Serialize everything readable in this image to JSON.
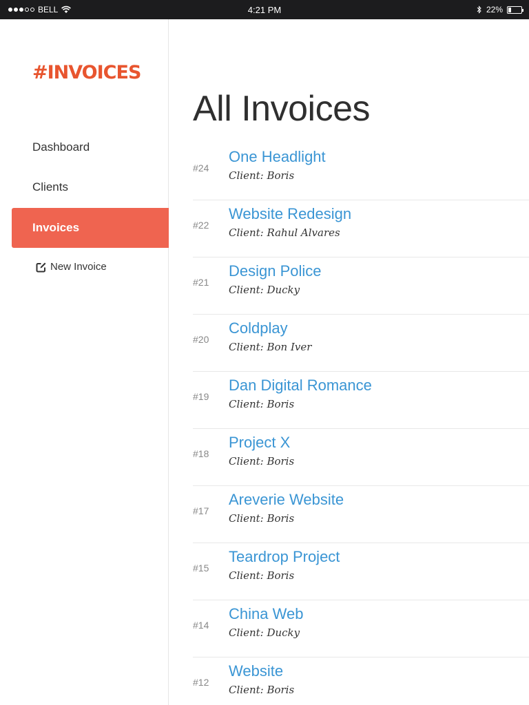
{
  "status_bar": {
    "carrier": "BELL",
    "time": "4:21 PM",
    "battery": "22%",
    "battery_level": 0.22,
    "icons": [
      "signal-dots",
      "wifi-icon",
      "bluetooth-icon",
      "battery-icon"
    ]
  },
  "sidebar": {
    "logo": "#INVOICES",
    "items": [
      {
        "label": "Dashboard",
        "active": false
      },
      {
        "label": "Clients",
        "active": false
      },
      {
        "label": "Invoices",
        "active": true
      }
    ],
    "new_invoice": "New Invoice"
  },
  "main": {
    "title": "All Invoices",
    "invoices": [
      {
        "number": "#24",
        "name": "One Headlight",
        "client": "Client: Boris"
      },
      {
        "number": "#22",
        "name": "Website Redesign",
        "client": "Client: Rahul Alvares"
      },
      {
        "number": "#21",
        "name": "Design Police",
        "client": "Client: Ducky"
      },
      {
        "number": "#20",
        "name": "Coldplay",
        "client": "Client: Bon Iver"
      },
      {
        "number": "#19",
        "name": "Dan Digital Romance",
        "client": "Client: Boris"
      },
      {
        "number": "#18",
        "name": "Project X",
        "client": "Client: Boris"
      },
      {
        "number": "#17",
        "name": "Areverie Website",
        "client": "Client: Boris"
      },
      {
        "number": "#15",
        "name": "Teardrop Project",
        "client": "Client: Boris"
      },
      {
        "number": "#14",
        "name": "China Web",
        "client": "Client: Ducky"
      },
      {
        "number": "#12",
        "name": "Website",
        "client": "Client: Boris"
      }
    ]
  },
  "colors": {
    "accent": "#ef6450",
    "logo": "#e8552f",
    "link": "#3a95d4"
  }
}
